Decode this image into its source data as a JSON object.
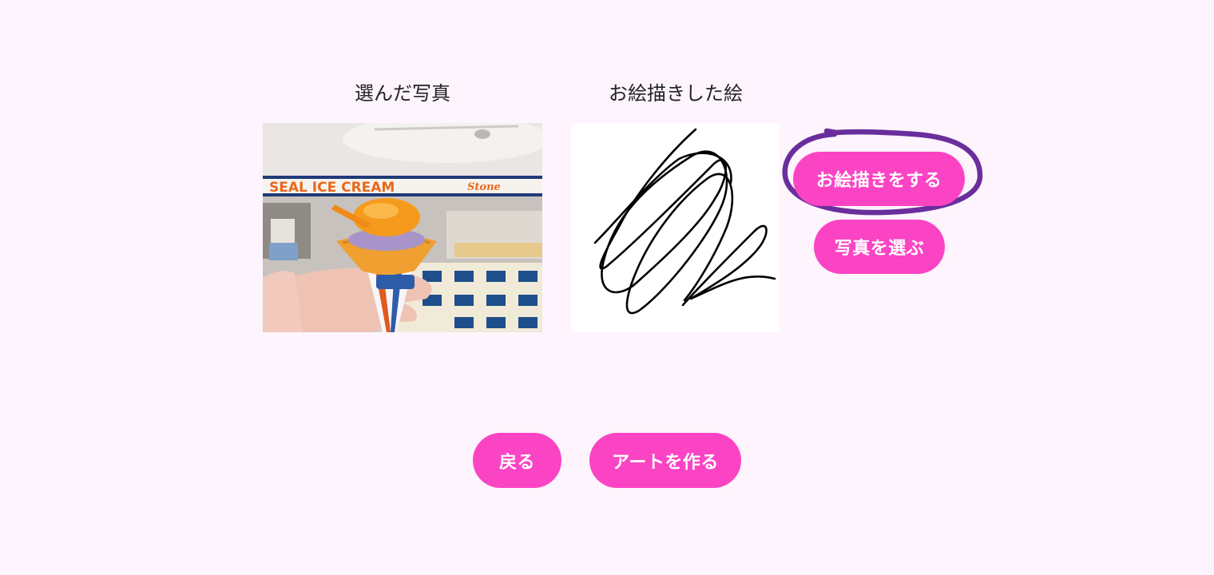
{
  "captions": {
    "selected_photo": "選んだ写真",
    "drawing": "お絵描きした絵"
  },
  "photo": {
    "sign_text": "SEAL ICE CREAM",
    "sign_text_right": "Stone"
  },
  "buttons": {
    "draw": "お絵描きをする",
    "select_photo": "写真を選ぶ",
    "back": "戻る",
    "create_art": "アートを作る"
  },
  "colors": {
    "background": "#fdf4fd",
    "button": "#fb44c4",
    "highlight": "#6a2e9c"
  }
}
